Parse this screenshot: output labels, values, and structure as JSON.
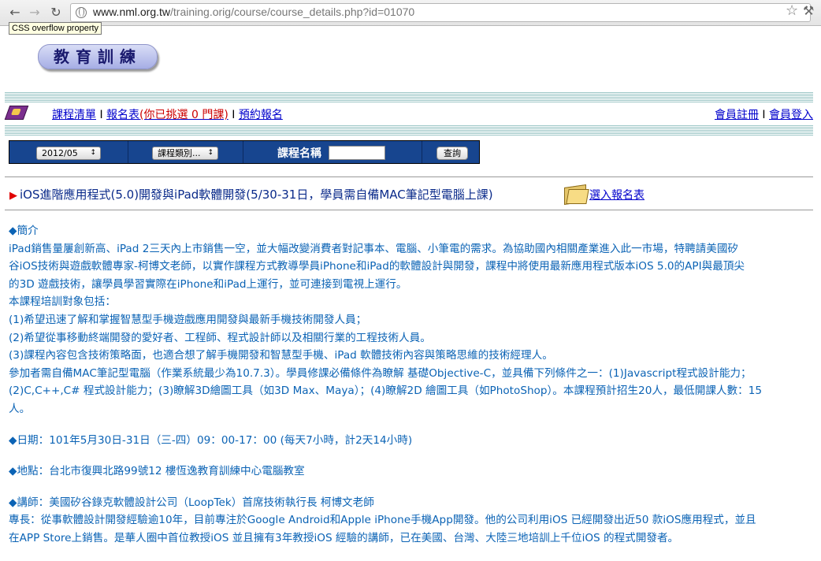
{
  "browser": {
    "url_host": "www.nml.org.tw",
    "url_path": "/training.orig/course/course_details.php?id=01070",
    "tooltip": "CSS overflow property"
  },
  "logo": {
    "text": "教育訓練"
  },
  "nav": {
    "course_list": "課程清單",
    "signup_form": "報名表",
    "selected_prefix": "(你已挑選 0 門課)",
    "reserve": "預約報名",
    "register": "會員註冊",
    "login": "會員登入"
  },
  "search": {
    "month_value": "2012/05",
    "category_value": "課程類別...",
    "name_label": "課程名稱",
    "name_value": "",
    "query_button": "查詢"
  },
  "course": {
    "title": "iOS進階應用程式(5.0)開發與iPad軟體開發(5/30-31日，學員需自備MAC筆記型電腦上課)",
    "enroll_link": "選入報名表"
  },
  "intro": {
    "heading": "◆簡介",
    "lines": [
      "iPad銷售量屢創新高、iPad 2三天內上市銷售一空，並大幅改變消費者對記事本、電腦、小筆電的需求。為協助國內相關產業進入此一市場，特聘請美國矽",
      "谷iOS技術與遊戲軟體專家-柯博文老師，以實作課程方式教導學員iPhone和iPad的軟體設計與開發，課程中將使用最新應用程式版本iOS 5.0的API與最頂尖",
      "的3D 遊戲技術，讓學員學習實際在iPhone和iPad上運行，並可連接到電視上運行。",
      "本課程培訓對象包括：",
      "(1)希望迅速了解和掌握智慧型手機遊戲應用開發與最新手機技術開發人員；",
      "(2)希望從事移動終端開發的愛好者、工程師、程式設計師以及相關行業的工程技術人員。",
      "(3)課程內容包含技術策略面，也適合想了解手機開發和智慧型手機、iPad 軟體技術內容與策略思維的技術經理人。",
      "參加者需自備MAC筆記型電腦（作業系統最少為10.7.3）。學員修課必備條件為瞭解 基礎Objective-C，並具備下列條件之一：(1)Javascript程式設計能力；",
      "(2)C,C++,C# 程式設計能力；(3)瞭解3D繪圖工具（如3D Max、Maya）；(4)瞭解2D 繪圖工具（如PhotoShop）。本課程預計招生20人，最低開課人數：15",
      "人。"
    ]
  },
  "date": {
    "text": "◆日期：101年5月30日-31日（三-四）09：00-17：00 (每天7小時，計2天14小時)"
  },
  "location": {
    "text": "◆地點：台北市復興北路99號12 樓恆逸教育訓練中心電腦教室"
  },
  "instructor": {
    "text": "◆講師：美國矽谷錄克軟體設計公司（LoopTek）首席技術執行長 柯博文老師",
    "lines": [
      "專長：從事軟體設計開發經驗逾10年，目前專注於Google Android和Apple iPhone手機App開發。他的公司利用iOS 已經開發出近50 款iOS應用程式，並且",
      "在APP Store上銷售。是華人圈中首位教授iOS 並且擁有3年教授iOS 經驗的講師，已在美國、台灣、大陸三地培訓上千位iOS 的程式開發者。"
    ]
  }
}
